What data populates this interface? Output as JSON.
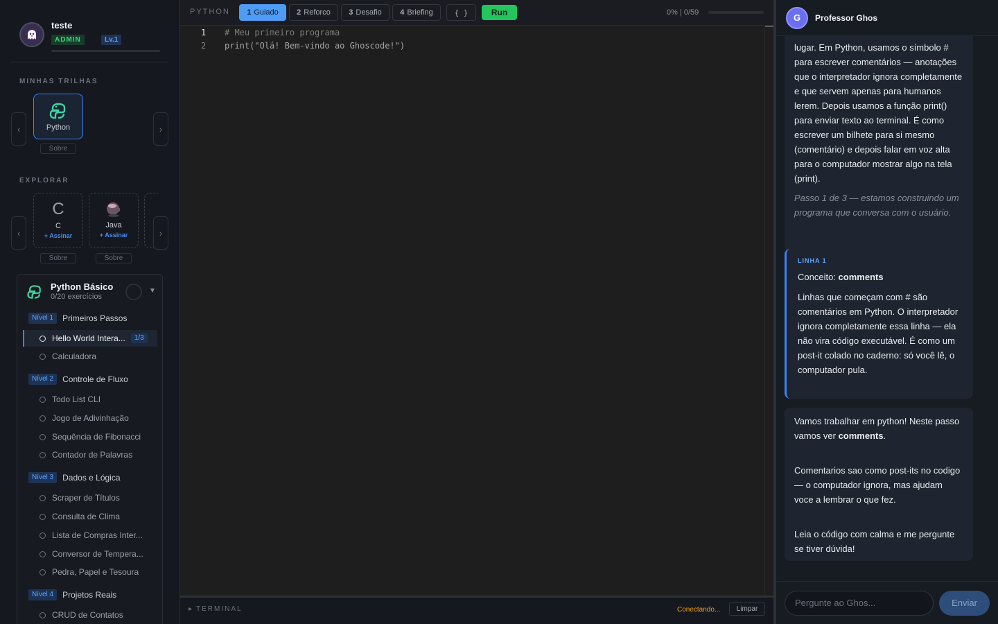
{
  "sidebar": {
    "user": {
      "name": "teste",
      "role": "ADMIN",
      "level": "Lv.1"
    },
    "my_tracks_title": "MINHAS TRILHAS",
    "my_tracks": [
      {
        "name": "Python",
        "about": "Sobre"
      }
    ],
    "explore_title": "EXPLORAR",
    "explore": [
      {
        "name": "C",
        "subscribe": "+ Assinar",
        "about": "Sobre",
        "icon": "c-letter-icon"
      },
      {
        "name": "Java",
        "subscribe": "+ Assinar",
        "about": "Sobre",
        "icon": "coffee-cup-icon"
      }
    ],
    "course": {
      "title": "Python Básico",
      "subtitle": "0/20 exercícios",
      "levels": [
        {
          "badge": "Nível 1",
          "name": "Primeiros Passos",
          "items": [
            {
              "label": "Hello World Intera...",
              "count": "1/3",
              "active": true
            },
            {
              "label": "Calculadora"
            }
          ]
        },
        {
          "badge": "Nível 2",
          "name": "Controle de Fluxo",
          "items": [
            {
              "label": "Todo List CLI"
            },
            {
              "label": "Jogo de Adivinhação"
            },
            {
              "label": "Sequência de Fibonacci"
            },
            {
              "label": "Contador de Palavras"
            }
          ]
        },
        {
          "badge": "Nível 3",
          "name": "Dados e Lógica",
          "items": [
            {
              "label": "Scraper de Títulos"
            },
            {
              "label": "Consulta de Clima"
            },
            {
              "label": "Lista de Compras Inter..."
            },
            {
              "label": "Conversor de Tempera..."
            },
            {
              "label": "Pedra, Papel e Tesoura"
            }
          ]
        },
        {
          "badge": "Nível 4",
          "name": "Projetos Reais",
          "items": [
            {
              "label": "CRUD de Contatos"
            }
          ]
        }
      ]
    }
  },
  "toolbar": {
    "language": "PYTHON",
    "tabs": [
      {
        "num": "1",
        "label": "Guiado",
        "selected": true
      },
      {
        "num": "2",
        "label": "Reforco"
      },
      {
        "num": "3",
        "label": "Desafio"
      },
      {
        "num": "4",
        "label": "Briefing"
      }
    ],
    "format_label": "{ }",
    "run_label": "Run",
    "progress_text": "0% | 0/59",
    "progress_value": 0
  },
  "editor": {
    "lines": [
      {
        "num": "1",
        "text": "# Meu primeiro programa"
      },
      {
        "num": "2",
        "text": "print(\"Olá! Bem-vindo ao Ghoscode!\")"
      }
    ]
  },
  "terminal": {
    "label": "TERMINAL",
    "status": "Conectando...",
    "clear_label": "Limpar"
  },
  "chat": {
    "avatar_letter": "G",
    "title": "Professor Ghos",
    "message1": "lugar. Em Python, usamos o símbolo # para escrever comentários — anotações que o interpretador ignora completamente e que servem apenas para humanos lerem. Depois usamos a função print() para enviar texto ao terminal. É como escrever um bilhete para si mesmo (comentário) e depois falar em voz alta para o computador mostrar algo na tela (print).",
    "message1_step": "Passo 1 de 3 — estamos construindo um programa que conversa com o usuário.",
    "concept_tag": "LINHA 1",
    "concept_prefix": "Conceito: ",
    "concept_name": "comments",
    "concept_body": "Linhas que começam com # são comentários em Python. O interpretador ignora completamente essa linha — ela não vira código executável. É como um post-it colado no caderno: só você lê, o computador pula.",
    "message3_p1_a": "Vamos trabalhar em python! Neste passo vamos ver ",
    "message3_p1_b": "comments",
    "message3_p1_c": ".",
    "message3_p2": "Comentarios sao como post-its no codigo — o computador ignora, mas ajudam voce a lembrar o que fez.",
    "message3_p3": "Leia o código com calma e me pergunte se tiver dúvida!",
    "input_placeholder": "Pergunte ao Ghos...",
    "send_label": "Enviar"
  },
  "colors": {
    "accent": "#3b82f6",
    "run": "#22c55e",
    "python": "#3fd3a2",
    "status_warn": "#f0a020"
  }
}
